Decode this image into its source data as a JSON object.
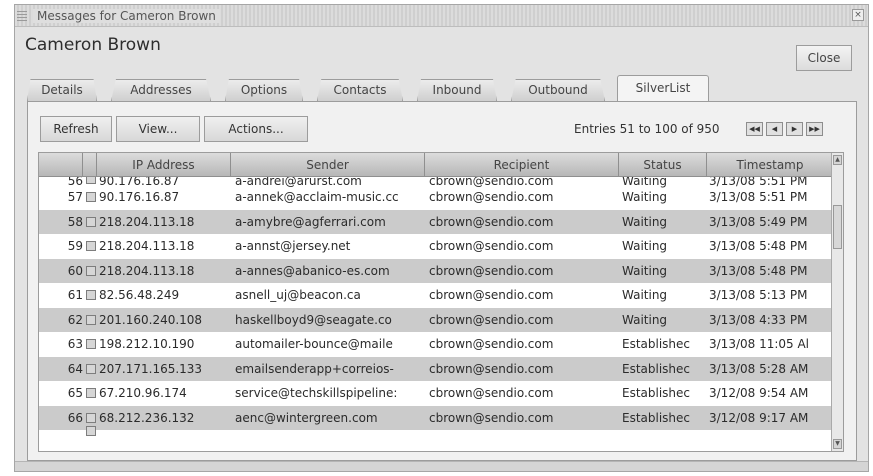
{
  "window": {
    "title": "Messages for Cameron Brown",
    "close_x": "×"
  },
  "header": {
    "name": "Cameron Brown",
    "close_label": "Close"
  },
  "tabs": [
    {
      "label": "Details",
      "active": false
    },
    {
      "label": "Addresses",
      "active": false
    },
    {
      "label": "Options",
      "active": false
    },
    {
      "label": "Contacts",
      "active": false
    },
    {
      "label": "Inbound",
      "active": false
    },
    {
      "label": "Outbound",
      "active": false
    },
    {
      "label": "SilverList",
      "active": true
    }
  ],
  "toolbar": {
    "refresh": "Refresh",
    "view": "View...",
    "actions": "Actions..."
  },
  "pager": {
    "entries_text": "Entries 51 to 100 of 950",
    "first": "◀◀",
    "prev": "◀",
    "next": "▶",
    "last": "▶▶"
  },
  "table": {
    "columns": [
      "IP Address",
      "Sender",
      "Recipient",
      "Status",
      "Timestamp"
    ],
    "rows": [
      {
        "num": "56",
        "ip": "90.176.16.87",
        "sender": "a-andrei@arurst.com",
        "recipient": "cbrown@sendio.com",
        "status": "Waiting",
        "ts": "3/13/08 5:51 PM"
      },
      {
        "num": "57",
        "ip": "90.176.16.87",
        "sender": "a-annek@acclaim-music.cc",
        "recipient": "cbrown@sendio.com",
        "status": "Waiting",
        "ts": "3/13/08 5:51 PM"
      },
      {
        "num": "58",
        "ip": "218.204.113.18",
        "sender": "a-amybre@agferrari.com",
        "recipient": "cbrown@sendio.com",
        "status": "Waiting",
        "ts": "3/13/08 5:49 PM"
      },
      {
        "num": "59",
        "ip": "218.204.113.18",
        "sender": "a-annst@jersey.net",
        "recipient": "cbrown@sendio.com",
        "status": "Waiting",
        "ts": "3/13/08 5:48 PM"
      },
      {
        "num": "60",
        "ip": "218.204.113.18",
        "sender": "a-annes@abanico-es.com",
        "recipient": "cbrown@sendio.com",
        "status": "Waiting",
        "ts": "3/13/08 5:48 PM"
      },
      {
        "num": "61",
        "ip": "82.56.48.249",
        "sender": "asnell_uj@beacon.ca",
        "recipient": "cbrown@sendio.com",
        "status": "Waiting",
        "ts": "3/13/08 5:13 PM"
      },
      {
        "num": "62",
        "ip": "201.160.240.108",
        "sender": "haskellboyd9@seagate.co",
        "recipient": "cbrown@sendio.com",
        "status": "Waiting",
        "ts": "3/13/08 4:33 PM"
      },
      {
        "num": "63",
        "ip": "198.212.10.190",
        "sender": "automailer-bounce@maile",
        "recipient": "cbrown@sendio.com",
        "status": "Establishec",
        "ts": "3/13/08 11:05 Al"
      },
      {
        "num": "64",
        "ip": "207.171.165.133",
        "sender": "emailsenderapp+correios-",
        "recipient": "cbrown@sendio.com",
        "status": "Establishec",
        "ts": "3/13/08 5:28 AM"
      },
      {
        "num": "65",
        "ip": "67.210.96.174",
        "sender": "service@techskillspipeline:",
        "recipient": "cbrown@sendio.com",
        "status": "Establishec",
        "ts": "3/12/08 9:54 AM"
      },
      {
        "num": "66",
        "ip": "68.212.236.132",
        "sender": "aenc@wintergreen.com",
        "recipient": "cbrown@sendio.com",
        "status": "Establishec",
        "ts": "3/12/08 9:17 AM"
      },
      {
        "num": "",
        "ip": "",
        "sender": "",
        "recipient": "",
        "status": "",
        "ts": ""
      }
    ]
  },
  "scroll": {
    "up": "▲",
    "down": "▼"
  }
}
